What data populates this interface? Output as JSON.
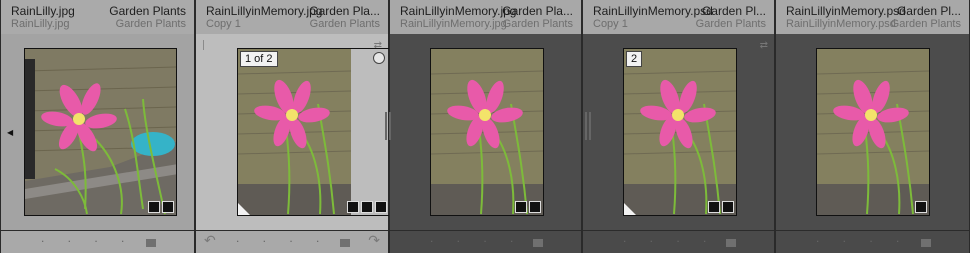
{
  "cells": [
    {
      "filename": "RainLilly.jpg",
      "copy_name": "RainLilly.jpg",
      "collection": "Garden Plants",
      "collection_sub": "Garden Plants",
      "badge": "",
      "icons": [
        "metadata-tag-icon",
        "adjustments-icon"
      ]
    },
    {
      "filename": "RainLillyinMemory.jpg",
      "copy_name": "Copy 1",
      "collection": "Garden Pla...",
      "collection_sub": "Garden Plants",
      "badge": "1 of 2",
      "icons": [
        "metadata-tag-icon",
        "adjustments-icon",
        "crop-icon"
      ]
    },
    {
      "filename": "RainLillyinMemory.jpg",
      "copy_name": "RainLillyinMemory.jpg",
      "collection": "Garden Pla...",
      "collection_sub": "Garden Plants",
      "badge": "",
      "icons": [
        "metadata-tag-icon",
        "adjustments-icon"
      ]
    },
    {
      "filename": "RainLillyinMemory.psd",
      "copy_name": "Copy 1",
      "collection": "Garden Pl...",
      "collection_sub": "Garden Plants",
      "badge": "2",
      "icons": [
        "adjustments-icon",
        "crop-icon"
      ]
    },
    {
      "filename": "RainLillyinMemory.psd",
      "copy_name": "RainLillyinMemory.psd",
      "collection": "Garden Pl...",
      "collection_sub": "Garden Plants",
      "badge": "",
      "icons": [
        "adjustments-icon"
      ]
    }
  ],
  "rotate_left_icon": "rotate-left-icon",
  "rotate_right_icon": "rotate-right-icon",
  "footer_dots": ". . . . .",
  "colors": {
    "selected_cell": "#bdbdbd",
    "cell": "#a3a3a3",
    "dark_cell": "#4c4c4c"
  }
}
